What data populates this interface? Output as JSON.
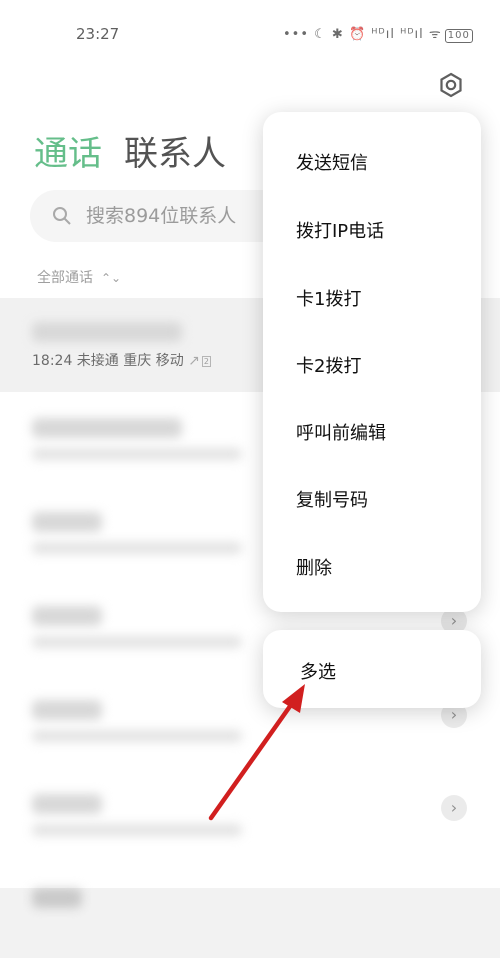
{
  "status_bar": {
    "time": "23:27",
    "icons_text": "••• ☾ ✱ ⏰ ᴴᴰıl ᴴᴰıl ᯤ",
    "battery": "100"
  },
  "header": {
    "tab_calls": "通话",
    "tab_contacts": "联系人"
  },
  "search": {
    "placeholder": "搜索894位联系人"
  },
  "filter": {
    "label": "全部通话",
    "chevron": "⌃⌄"
  },
  "call_log": {
    "first_detail": "18:24 未接通 重庆 移动",
    "first_arrow": "↗",
    "first_sim": "2"
  },
  "context_menu": {
    "items": [
      "发送短信",
      "拨打IP电话",
      "卡1拨打",
      "卡2拨打",
      "呼叫前编辑",
      "复制号码",
      "删除"
    ],
    "multi_select": "多选"
  },
  "colors": {
    "accent": "#2aa65d",
    "annotation": "#d11f1f"
  }
}
